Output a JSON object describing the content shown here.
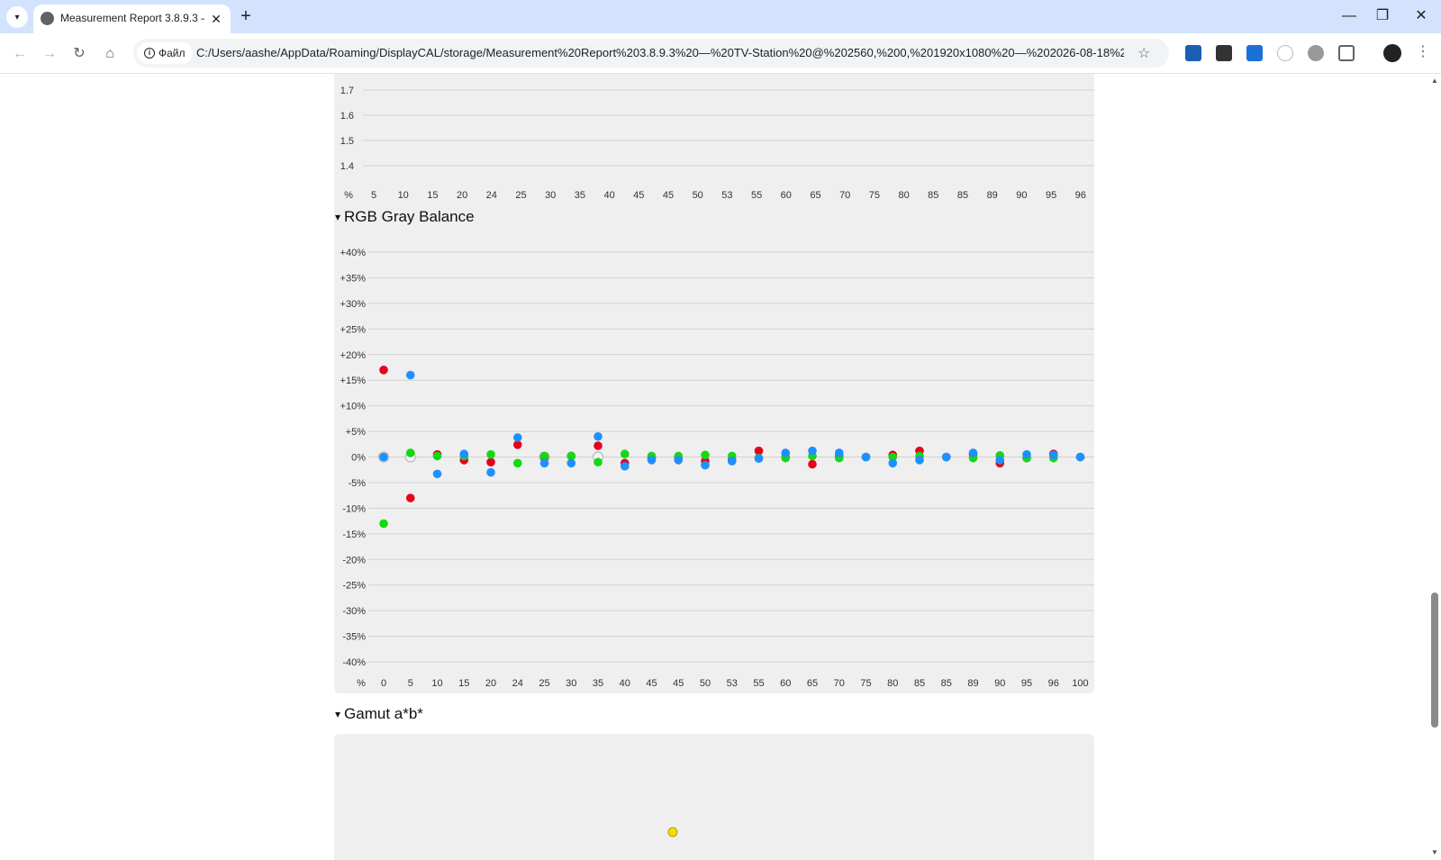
{
  "browser": {
    "tab_title": "Measurement Report 3.8.9.3 —",
    "site_label": "Файл",
    "url": "C:/Users/aashe/AppData/Roaming/DisplayCAL/storage/Measurement%20Report%203.8.9.3%20—%20TV-Station%20@%202560,%200,%201920x1080%20—%202026-08-18%202..."
  },
  "icons": {
    "tab_dropdown": "▾",
    "tab_close": "✕",
    "new_tab": "+",
    "minimize": "—",
    "restore": "❐",
    "close": "✕",
    "back": "←",
    "forward": "→",
    "reload": "↻",
    "home": "⌂",
    "info": "i",
    "star": "☆",
    "menu": "⋮",
    "scroll_up": "▲",
    "scroll_down": "▼"
  },
  "sections": {
    "gray_balance_title": "RGB Gray Balance",
    "gamut_title": "Gamut a*b*",
    "caret": "▾"
  },
  "colors": {
    "red": "#e8001c",
    "green": "#14d814",
    "blue": "#1e90ff",
    "yellow": "#f0e000",
    "neutral": "#bdbdbd"
  },
  "chart_data": [
    {
      "type": "line",
      "title": "",
      "y_ticks": [
        "1.7",
        "1.6",
        "1.5",
        "1.4"
      ],
      "x_unit_label": "%",
      "x_tick_labels": [
        "5",
        "10",
        "15",
        "20",
        "24",
        "25",
        "30",
        "35",
        "40",
        "45",
        "45",
        "50",
        "53",
        "55",
        "60",
        "65",
        "70",
        "75",
        "80",
        "85",
        "85",
        "89",
        "90",
        "95",
        "96"
      ],
      "grid": true
    },
    {
      "type": "scatter",
      "title": "RGB Gray Balance",
      "ylim": [
        -40,
        40
      ],
      "y_ticks": [
        "+40%",
        "+35%",
        "+30%",
        "+25%",
        "+20%",
        "+15%",
        "+10%",
        "+5%",
        "0%",
        "-5%",
        "-10%",
        "-15%",
        "-20%",
        "-25%",
        "-30%",
        "-35%",
        "-40%"
      ],
      "x_unit_label": "%",
      "categories": [
        "0",
        "5",
        "10",
        "15",
        "20",
        "24",
        "25",
        "30",
        "35",
        "40",
        "45",
        "45",
        "50",
        "53",
        "55",
        "60",
        "65",
        "70",
        "75",
        "80",
        "85",
        "85",
        "89",
        "90",
        "95",
        "96",
        "100"
      ],
      "grid": true,
      "series": [
        {
          "color": "#e8001c",
          "values": [
            17,
            -8,
            0.5,
            -0.6,
            -1,
            2.4,
            0,
            0.2,
            2.2,
            -1.2,
            -0.2,
            0,
            -0.8,
            -0.6,
            1.2,
            0,
            -1.4,
            0.2,
            0,
            0.4,
            1.2,
            0,
            0.5,
            -1.2,
            -0.2,
            0.6,
            0
          ]
        },
        {
          "color": "#14d814",
          "values": [
            -13,
            0.8,
            0.2,
            0.2,
            0.5,
            -1.2,
            0.2,
            0.2,
            -1,
            0.6,
            0.2,
            0.2,
            0.4,
            0.2,
            -0.2,
            -0.2,
            0.2,
            -0.2,
            0,
            0,
            0.2,
            0,
            -0.2,
            0.3,
            -0.2,
            -0.2,
            0
          ]
        },
        {
          "color": "#1e90ff",
          "values": [
            0,
            16,
            -3.3,
            0.6,
            -3,
            3.8,
            -1.2,
            -1.2,
            4,
            -1.8,
            -0.6,
            -0.6,
            -1.6,
            -0.8,
            -0.3,
            0.8,
            1.2,
            0.8,
            0,
            -1.2,
            -0.6,
            0,
            0.8,
            -0.6,
            0.5,
            0.4,
            0
          ]
        },
        {
          "color": "#bdbdbd",
          "values": [
            0,
            0,
            null,
            null,
            null,
            null,
            0,
            null,
            0,
            null,
            null,
            null,
            null,
            null,
            null,
            null,
            null,
            null,
            null,
            null,
            null,
            null,
            null,
            null,
            null,
            null,
            null
          ]
        }
      ]
    },
    {
      "type": "scatter",
      "title": "Gamut a*b*",
      "points": [
        {
          "color": "#f0e000",
          "a": 0,
          "b": 0
        }
      ]
    }
  ]
}
